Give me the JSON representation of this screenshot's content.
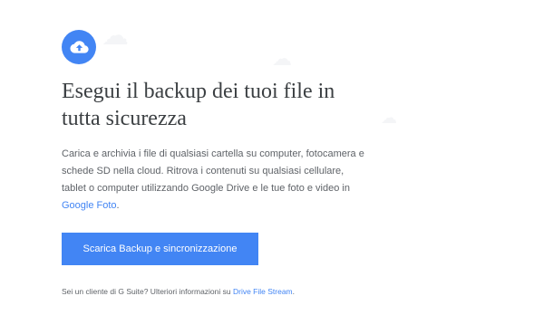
{
  "icon": {
    "name": "cloud-upload-icon",
    "background_color": "#4285f4"
  },
  "headline": {
    "line1": "Esegui il backup dei tuoi file in",
    "line2": "tutta sicurezza"
  },
  "description": {
    "text_before_link": "Carica e archivia i file di qualsiasi cartella su computer, fotocamera e schede SD nella cloud. Ritrova i contenuti su qualsiasi cellulare, tablet o computer utilizzando Google Drive e le tue foto e video in ",
    "link_text": "Google Foto",
    "text_after_link": "."
  },
  "download_button": {
    "label": "Scarica Backup e sincronizzazione",
    "color": "#4285f4"
  },
  "footnote": {
    "text_before_link": "Sei un cliente di G Suite? Ulteriori informazioni su ",
    "link_text": "Drive File Stream",
    "text_after_link": "."
  },
  "link_color": "#4285f4"
}
